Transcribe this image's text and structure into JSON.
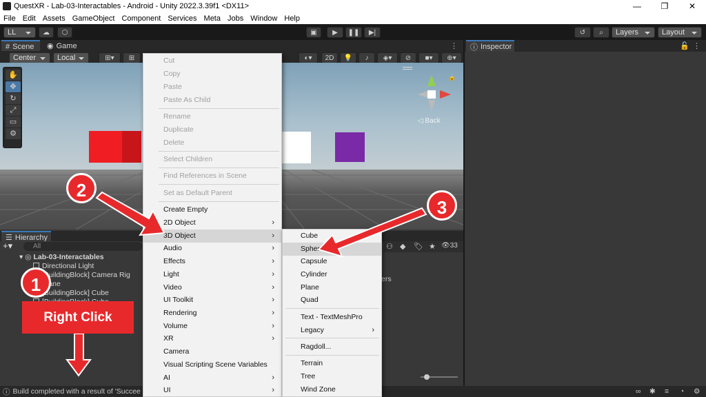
{
  "window": {
    "title": "QuestXR - Lab-03-Interactables - Android - Unity 2022.3.39f1 <DX11>",
    "minimize": "—",
    "maximize": "❐",
    "close": "✕"
  },
  "menu": [
    "File",
    "Edit",
    "Assets",
    "GameObject",
    "Component",
    "Services",
    "Meta",
    "Jobs",
    "Window",
    "Help"
  ],
  "toolbar": {
    "account": "LL",
    "layers": "Layers",
    "layout": "Layout"
  },
  "tabs": {
    "scene": "Scene",
    "game": "Game",
    "hierarchy": "Hierarchy",
    "inspector": "Inspector"
  },
  "scene_toolbar": {
    "pivot": "Center",
    "space": "Local",
    "mode2d": "2D",
    "back_label": "Back"
  },
  "hierarchy": {
    "search_placeholder": "All",
    "scene_name": "Lab-03-Interactables",
    "items": [
      "Directional Light",
      "[BuildingBlock] Camera Rig",
      "Plane",
      "[BuildingBlock] Cube",
      "[BuildingBlock] Cube"
    ],
    "right_fragment_1": "ers",
    "count": "33"
  },
  "context_menu": {
    "items": [
      {
        "label": "Cut",
        "disabled": true
      },
      {
        "label": "Copy",
        "disabled": true
      },
      {
        "label": "Paste",
        "disabled": true
      },
      {
        "label": "Paste As Child",
        "disabled": true
      },
      {
        "label": "Rename",
        "disabled": true
      },
      {
        "label": "Duplicate",
        "disabled": true
      },
      {
        "label": "Delete",
        "disabled": true
      },
      {
        "label": "Select Children",
        "disabled": true
      },
      {
        "label": "Find References in Scene",
        "disabled": true
      },
      {
        "label": "Set as Default Parent",
        "disabled": true
      },
      {
        "label": "Create Empty",
        "disabled": false
      },
      {
        "label": "2D Object",
        "disabled": false,
        "submenu": true
      },
      {
        "label": "3D Object",
        "disabled": false,
        "submenu": true
      },
      {
        "label": "Audio",
        "disabled": false,
        "submenu": true
      },
      {
        "label": "Effects",
        "disabled": false,
        "submenu": true
      },
      {
        "label": "Light",
        "disabled": false,
        "submenu": true
      },
      {
        "label": "Video",
        "disabled": false,
        "submenu": true
      },
      {
        "label": "UI Toolkit",
        "disabled": false,
        "submenu": true
      },
      {
        "label": "Rendering",
        "disabled": false,
        "submenu": true
      },
      {
        "label": "Volume",
        "disabled": false,
        "submenu": true
      },
      {
        "label": "XR",
        "disabled": false,
        "submenu": true
      },
      {
        "label": "Camera",
        "disabled": false
      },
      {
        "label": "Visual Scripting Scene Variables",
        "disabled": false
      },
      {
        "label": "AI",
        "disabled": false,
        "submenu": true
      },
      {
        "label": "UI",
        "disabled": false,
        "submenu": true
      }
    ]
  },
  "submenu_3d": {
    "items": [
      {
        "label": "Cube"
      },
      {
        "label": "Sphere"
      },
      {
        "label": "Capsule"
      },
      {
        "label": "Cylinder"
      },
      {
        "label": "Plane"
      },
      {
        "label": "Quad"
      },
      {
        "label": "Text - TextMeshPro"
      },
      {
        "label": "Legacy",
        "submenu": true
      },
      {
        "label": "Ragdoll..."
      },
      {
        "label": "Terrain"
      },
      {
        "label": "Tree"
      },
      {
        "label": "Wind Zone"
      }
    ]
  },
  "annotations": {
    "step1": "1",
    "step2": "2",
    "step3": "3",
    "right_click": "Right Click"
  },
  "status": {
    "message": "Build completed with a result of 'Succee"
  },
  "colors": {
    "red_cube": "#f01e23",
    "white_cube": "#ffffff",
    "purple_cube": "#7a2aa6",
    "annotation_red": "#e8292c",
    "accent_blue": "#3a79bb"
  }
}
